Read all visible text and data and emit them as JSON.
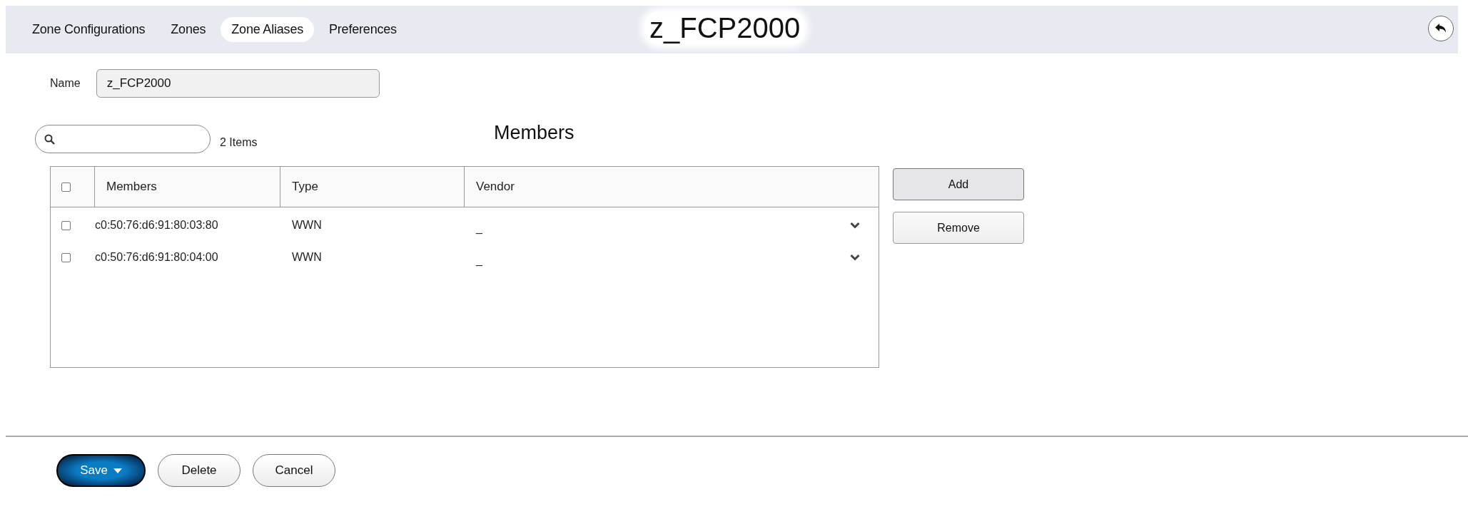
{
  "header": {
    "tabs": [
      {
        "label": "Zone Configurations",
        "selected": false
      },
      {
        "label": "Zones",
        "selected": false
      },
      {
        "label": "Zone Aliases",
        "selected": true
      },
      {
        "label": "Preferences",
        "selected": false
      }
    ],
    "title": "z_FCP2000"
  },
  "name_field": {
    "label": "Name",
    "value": "z_FCP2000"
  },
  "members": {
    "count": "2 Items",
    "heading": "Members",
    "table": {
      "select_all": {
        "checked": false
      },
      "columns": [
        "Members",
        "Type",
        "Vendor"
      ],
      "rows": [
        {
          "checked": false,
          "member": "c0:50:76:d6:91:80:03:80",
          "type": "WWN",
          "vendor": "_"
        },
        {
          "checked": false,
          "member": "c0:50:76:d6:91:80:04:00",
          "type": "WWN",
          "vendor": "_"
        }
      ]
    },
    "buttons": [
      "Add",
      "Remove"
    ]
  },
  "footer": {
    "buttons": [
      {
        "label": "Save",
        "kind": "primary"
      },
      {
        "label": "Delete",
        "kind": "secondary"
      },
      {
        "label": "Cancel",
        "kind": "secondary"
      }
    ]
  }
}
